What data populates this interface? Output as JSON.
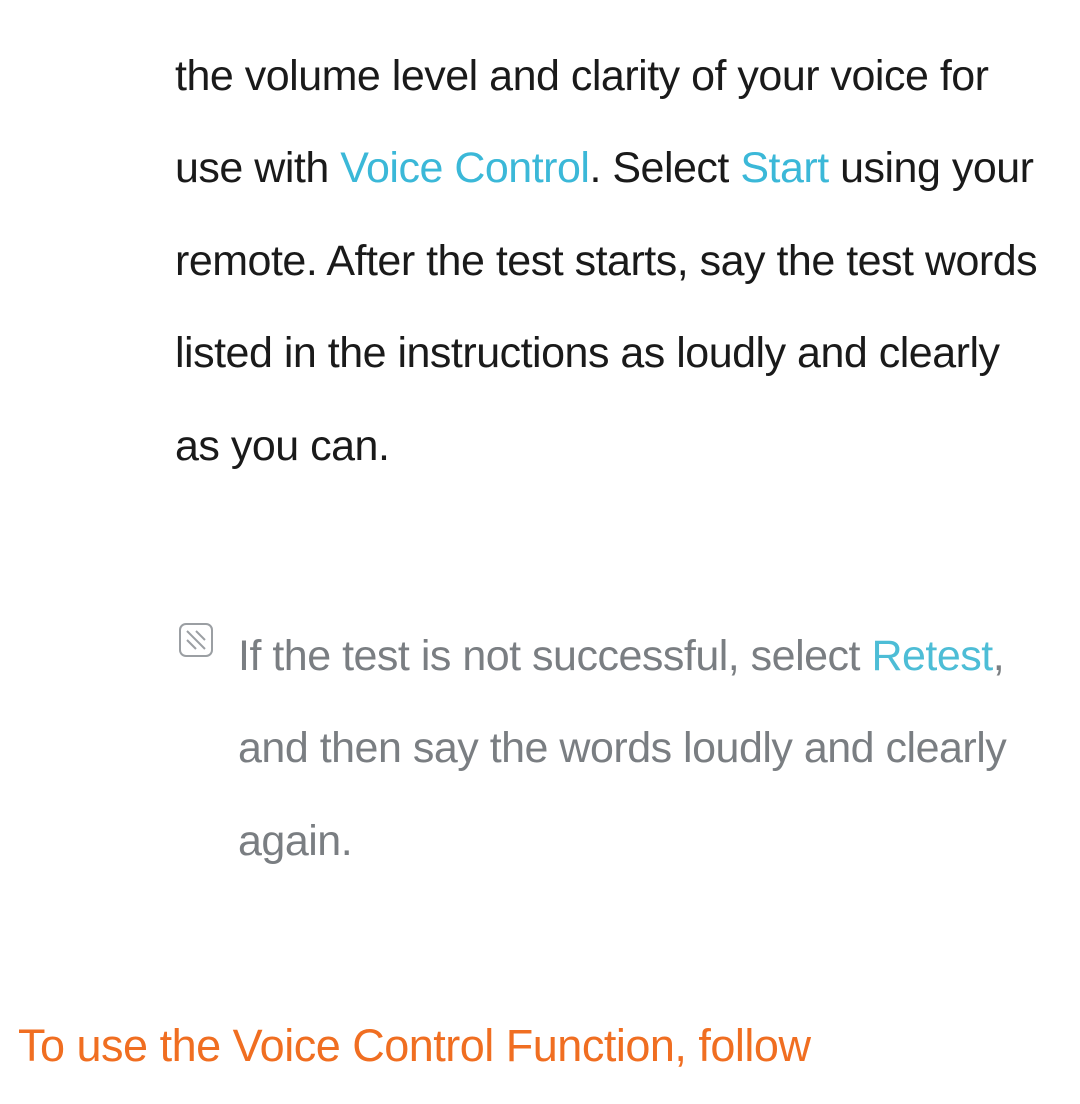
{
  "main": {
    "text_before_vc": "the volume level and clarity of your voice for use with ",
    "voice_control": "Voice Control",
    "text_after_vc": ". Select ",
    "start": "Start",
    "text_after_start": " using your remote. After the test starts, say the test words listed in the instructions as loudly and clearly as you can."
  },
  "note": {
    "text_before_retest": "If the test is not successful, select ",
    "retest": "Retest",
    "text_after_retest": ", and then say the words loudly and clearly again."
  },
  "heading": {
    "text": "To use the Voice Control Function, follow"
  }
}
